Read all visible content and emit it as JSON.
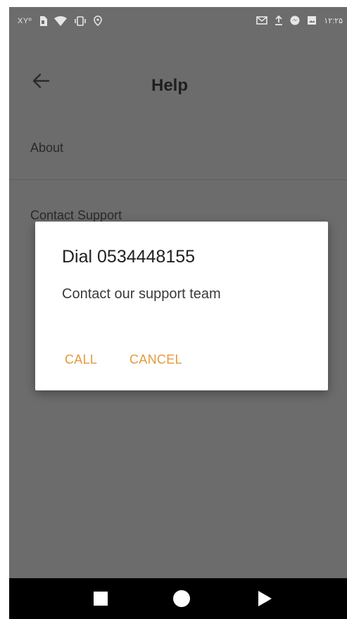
{
  "status_bar": {
    "left_text": "ΧΥº",
    "time": "۱۲:۲۵",
    "icons_left": [
      "sim-icon",
      "wifi-icon",
      "vibrate-icon",
      "location-icon"
    ],
    "icons_right": [
      "gmail-icon",
      "upload-icon",
      "messenger-icon",
      "image-icon"
    ]
  },
  "app_bar": {
    "title": "Help",
    "back_icon": "arrow-left-icon"
  },
  "menu": {
    "items": [
      {
        "label": "About"
      },
      {
        "label": "Contact Support"
      }
    ]
  },
  "dialog": {
    "title": "Dial 0534448155",
    "message": "Contact our support team",
    "call_label": "CALL",
    "cancel_label": "CANCEL",
    "accent_color": "#e49a3c"
  },
  "nav_bar": {
    "icons": [
      "recents-square-icon",
      "home-circle-icon",
      "back-triangle-icon"
    ]
  },
  "colors": {
    "scrim": "#6c6c6c",
    "dialog_bg": "#ffffff",
    "nav_bg": "#000000"
  }
}
